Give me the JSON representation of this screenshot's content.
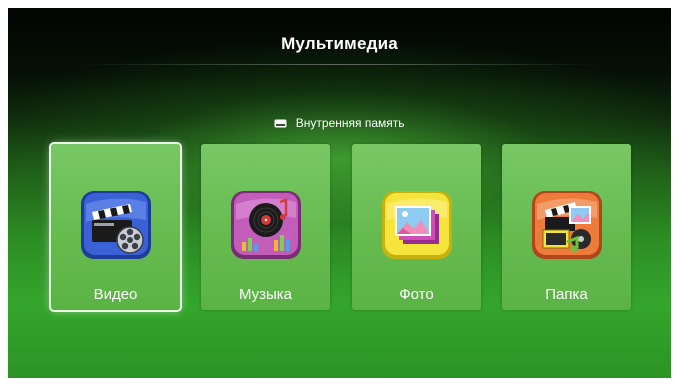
{
  "header": {
    "title": "Мультимедиа"
  },
  "storage": {
    "label": "Внутренняя память",
    "icon": "drive-icon"
  },
  "tiles": [
    {
      "label": "Видео",
      "icon": "video-icon",
      "selected": true
    },
    {
      "label": "Музыка",
      "icon": "music-icon",
      "selected": false
    },
    {
      "label": "Фото",
      "icon": "photo-icon",
      "selected": false
    },
    {
      "label": "Папка",
      "icon": "folder-icon",
      "selected": false
    }
  ],
  "colors": {
    "tile_green": "#66bb4f",
    "background_top": "#020402",
    "background_bottom": "#2b9423",
    "video_icon": "#2f55c8",
    "music_icon": "#b84fb0",
    "photo_icon": "#f2e23a",
    "folder_icon": "#e8763a"
  }
}
